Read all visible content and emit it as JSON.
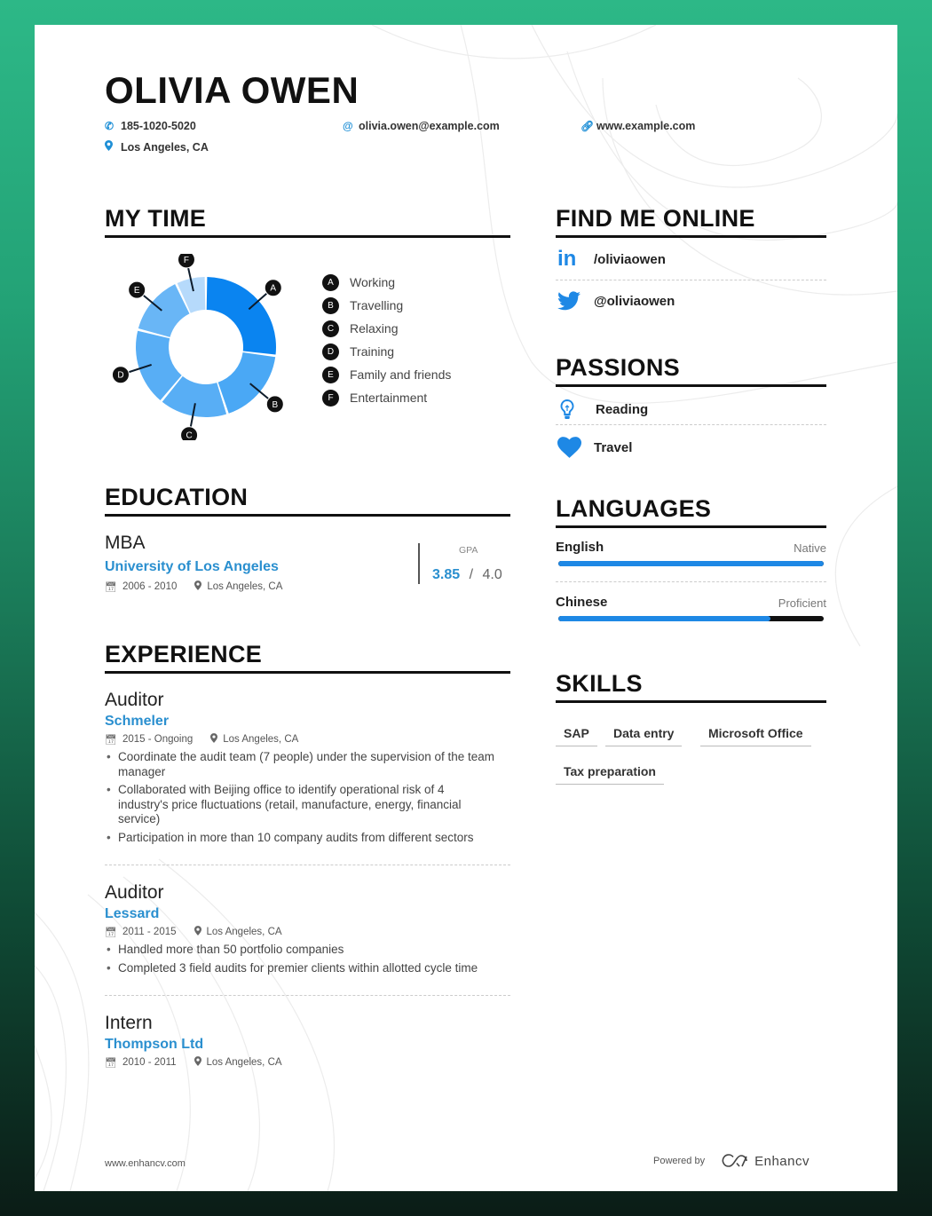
{
  "header": {
    "name": "OLIVIA OWEN",
    "phone": "185-1020-5020",
    "email": "olivia.owen@example.com",
    "website": "www.example.com",
    "location": "Los Angeles, CA",
    "icons": {
      "phone": "phone-icon",
      "email": "at-icon",
      "website": "link-icon",
      "location": "map-pin-icon"
    }
  },
  "my_time": {
    "title": "MY TIME",
    "legend": [
      {
        "key": "A",
        "label": "Working"
      },
      {
        "key": "B",
        "label": "Travelling"
      },
      {
        "key": "C",
        "label": "Relaxing"
      },
      {
        "key": "D",
        "label": "Training"
      },
      {
        "key": "E",
        "label": "Family and friends"
      },
      {
        "key": "F",
        "label": "Entertainment"
      }
    ]
  },
  "chart_data": {
    "type": "pie",
    "variant": "donut",
    "title": "MY TIME",
    "categories": [
      "Working",
      "Travelling",
      "Relaxing",
      "Training",
      "Family and friends",
      "Entertainment"
    ],
    "keys": [
      "A",
      "B",
      "C",
      "D",
      "E",
      "F"
    ],
    "values": [
      27,
      18,
      16,
      18,
      14,
      7
    ],
    "unit": "percent (estimated)",
    "colors": [
      "#0a84f0",
      "#4aa8f5",
      "#58aef5",
      "#58aef5",
      "#69b6f6",
      "#b6dafb"
    ],
    "legend": "right"
  },
  "education": {
    "title": "EDUCATION",
    "degree": "MBA",
    "school": "University of Los Angeles",
    "dates": "2006 - 2010",
    "location": "Los Angeles, CA",
    "gpa_label": "GPA",
    "gpa_value": "3.85",
    "gpa_sep": "/",
    "gpa_max": "4.0"
  },
  "experience": {
    "title": "EXPERIENCE",
    "items": [
      {
        "role": "Auditor",
        "company": "Schmeler",
        "dates": "2015 - Ongoing",
        "location": "Los Angeles, CA",
        "bullets": [
          "Coordinate the audit team (7 people) under the supervision of the team manager",
          "Collaborated with Beijing office to identify operational risk of 4 industry's price fluctuations (retail, manufacture, energy, financial service)",
          "Participation in more than 10 company audits from different sectors"
        ]
      },
      {
        "role": "Auditor",
        "company": "Lessard",
        "dates": "2011 - 2015",
        "location": "Los Angeles, CA",
        "bullets": [
          "Handled more than 50 portfolio companies",
          "Completed 3 field audits for premier clients within allotted cycle time"
        ]
      },
      {
        "role": "Intern",
        "company": "Thompson Ltd",
        "dates": "2010 - 2011",
        "location": "Los Angeles, CA",
        "bullets": []
      }
    ]
  },
  "find_me_online": {
    "title": "FIND ME ONLINE",
    "items": [
      {
        "icon": "linkedin-icon",
        "handle": "/oliviaowen"
      },
      {
        "icon": "twitter-icon",
        "handle": "@oliviaowen"
      }
    ]
  },
  "passions": {
    "title": "PASSIONS",
    "items": [
      {
        "icon": "lightbulb-icon",
        "label": "Reading"
      },
      {
        "icon": "heart-icon",
        "label": "Travel"
      }
    ]
  },
  "languages": {
    "title": "LANGUAGES",
    "items": [
      {
        "name": "English",
        "level": "Native",
        "proficiency": 1.0
      },
      {
        "name": "Chinese",
        "level": "Proficient",
        "proficiency": 0.8
      }
    ]
  },
  "skills": {
    "title": "SKILLS",
    "items": [
      "SAP",
      "Data entry",
      "Microsoft Office",
      "Tax preparation"
    ]
  },
  "footer": {
    "left": "www.enhancv.com",
    "powered_by": "Powered by",
    "brand": "Enhancv"
  },
  "colors": {
    "accent": "#2a8fcf",
    "bar": "#1e88e5",
    "text": "#222222",
    "bg_top": "#2db887",
    "bg_bottom": "#0b1c16"
  }
}
